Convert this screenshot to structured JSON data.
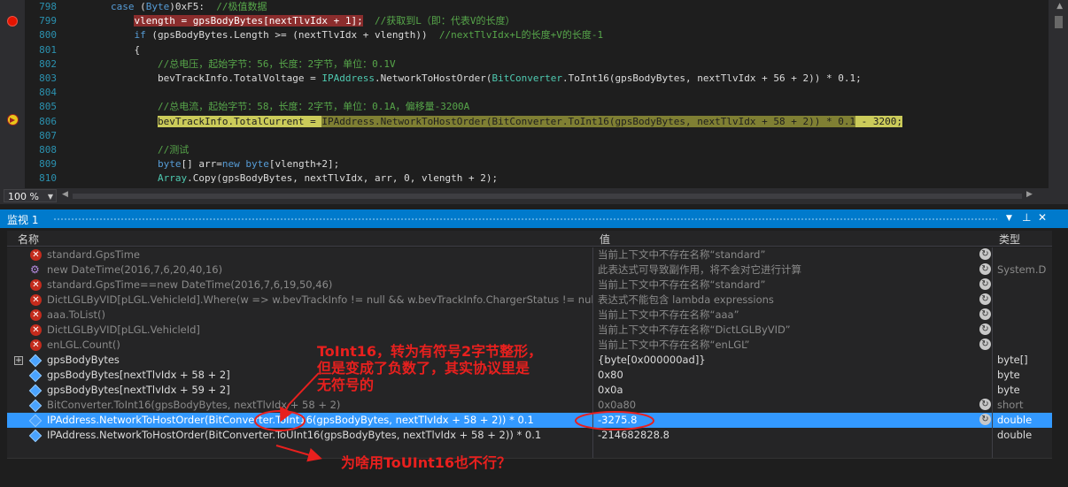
{
  "editor": {
    "lines": [
      {
        "num": "798",
        "segments": [
          {
            "t": "        ",
            "c": ""
          },
          {
            "t": "case",
            "c": "kw"
          },
          {
            "t": " (",
            "c": ""
          },
          {
            "t": "Byte",
            "c": "kw"
          },
          {
            "t": ")0xF5:  ",
            "c": ""
          },
          {
            "t": "//极值数据",
            "c": "cm"
          }
        ]
      },
      {
        "num": "799",
        "segments": [
          {
            "t": "            ",
            "c": ""
          },
          {
            "t": "vlength = gpsBodyBytes[nextTlvIdx + 1];",
            "c": "hl-red"
          },
          {
            "t": "  ",
            "c": ""
          },
          {
            "t": "//获取到L（即：代表V的长度）",
            "c": "cm"
          }
        ]
      },
      {
        "num": "800",
        "segments": [
          {
            "t": "            ",
            "c": ""
          },
          {
            "t": "if",
            "c": "kw"
          },
          {
            "t": " (gpsBodyBytes.Length >= (nextTlvIdx + vlength))  ",
            "c": ""
          },
          {
            "t": "//nextTlvIdx+L的长度+V的长度-1",
            "c": "cm"
          }
        ]
      },
      {
        "num": "801",
        "segments": [
          {
            "t": "            {",
            "c": ""
          }
        ]
      },
      {
        "num": "802",
        "segments": [
          {
            "t": "                ",
            "c": ""
          },
          {
            "t": "//总电压，起始字节：56，长度：2字节，单位：0.1V",
            "c": "cm"
          }
        ]
      },
      {
        "num": "803",
        "segments": [
          {
            "t": "                bevTrackInfo.TotalVoltage = ",
            "c": ""
          },
          {
            "t": "IPAddress",
            "c": "ty"
          },
          {
            "t": ".NetworkToHostOrder(",
            "c": ""
          },
          {
            "t": "BitConverter",
            "c": "ty"
          },
          {
            "t": ".ToInt16(gpsBodyBytes, nextTlvIdx + 56 + 2)) * 0.1;",
            "c": ""
          }
        ]
      },
      {
        "num": "804",
        "segments": [
          {
            "t": "",
            "c": ""
          }
        ]
      },
      {
        "num": "805",
        "segments": [
          {
            "t": "                ",
            "c": ""
          },
          {
            "t": "//总电流，起始字节：58，长度：2字节，单位：0.1A，偏移量-3200A",
            "c": "cm"
          }
        ]
      },
      {
        "num": "806",
        "segments": [
          {
            "t": "                ",
            "c": ""
          },
          {
            "t": "bevTrackInfo.TotalCurrent = ",
            "c": "hl-yel"
          },
          {
            "t": "IPAddress.NetworkToHostOrder(BitConverter.ToInt16(gpsBodyBytes, nextTlvIdx + 58 + 2)) * 0.1",
            "c": "hl-yel2"
          },
          {
            "t": " - 3200;",
            "c": "hl-yel"
          }
        ]
      },
      {
        "num": "807",
        "segments": [
          {
            "t": "",
            "c": ""
          }
        ]
      },
      {
        "num": "808",
        "segments": [
          {
            "t": "                ",
            "c": ""
          },
          {
            "t": "//测试",
            "c": "cm"
          }
        ]
      },
      {
        "num": "809",
        "segments": [
          {
            "t": "                ",
            "c": ""
          },
          {
            "t": "byte",
            "c": "kw"
          },
          {
            "t": "[] arr=",
            "c": ""
          },
          {
            "t": "new",
            "c": "kw"
          },
          {
            "t": " ",
            "c": ""
          },
          {
            "t": "byte",
            "c": "kw"
          },
          {
            "t": "[vlength+2];",
            "c": ""
          }
        ]
      },
      {
        "num": "810",
        "segments": [
          {
            "t": "                ",
            "c": ""
          },
          {
            "t": "Array",
            "c": "ty"
          },
          {
            "t": ".Copy(gpsBodyBytes, nextTlvIdx, arr, 0, vlength + 2);",
            "c": ""
          }
        ]
      }
    ],
    "zoom": "100 %"
  },
  "watch": {
    "title": "监视 1",
    "headers": {
      "name": "名称",
      "value": "值",
      "type": "类型"
    },
    "rows": [
      {
        "icon": "error",
        "name": "standard.GpsTime",
        "value": "当前上下文中不存在名称“standard”",
        "type": "",
        "dim": true,
        "refresh": true
      },
      {
        "icon": "gear",
        "name": "new DateTime(2016,7,6,20,40,16)",
        "value": "此表达式可导致副作用，将不会对它进行计算",
        "type": "System.D",
        "dim": true,
        "refresh": true
      },
      {
        "icon": "error",
        "name": "standard.GpsTime==new DateTime(2016,7,6,19,50,46)",
        "value": "当前上下文中不存在名称“standard”",
        "type": "",
        "dim": true,
        "refresh": true
      },
      {
        "icon": "error",
        "name": "DictLGLByVID[pLGL.VehicleId].Where(w => w.bevTrackInfo != null && w.bevTrackInfo.ChargerStatus != null)",
        "value": "表达式不能包含 lambda expressions",
        "type": "",
        "dim": true,
        "refresh": true
      },
      {
        "icon": "error",
        "name": "aaa.ToList()",
        "value": "当前上下文中不存在名称“aaa”",
        "type": "",
        "dim": true,
        "refresh": true
      },
      {
        "icon": "error",
        "name": "DictLGLByVID[pLGL.VehicleId]",
        "value": "当前上下文中不存在名称“DictLGLByVID”",
        "type": "",
        "dim": true,
        "refresh": true
      },
      {
        "icon": "error",
        "name": "enLGL.Count()",
        "value": "当前上下文中不存在名称“enLGL”",
        "type": "",
        "dim": true,
        "refresh": true
      },
      {
        "icon": "cube",
        "name": "gpsBodyBytes",
        "value": "{byte[0x000000ad]}",
        "type": "byte[]",
        "dim": false,
        "refresh": false,
        "expand": true
      },
      {
        "icon": "cube",
        "name": "gpsBodyBytes[nextTlvIdx + 58 + 2]",
        "value": "0x80",
        "type": "byte",
        "dim": false,
        "refresh": false
      },
      {
        "icon": "cube",
        "name": "gpsBodyBytes[nextTlvIdx + 59 + 2]",
        "value": "0x0a",
        "type": "byte",
        "dim": false,
        "refresh": false
      },
      {
        "icon": "cube",
        "name": "BitConverter.ToInt16(gpsBodyBytes, nextTlvIdx + 58 + 2)",
        "value": "0x0a80",
        "type": "short",
        "dim": true,
        "refresh": true
      },
      {
        "icon": "cube",
        "name": "IPAddress.NetworkToHostOrder(BitConverter.ToInt16(gpsBodyBytes, nextTlvIdx + 58 + 2)) * 0.1",
        "value": "-3275.8",
        "type": "double",
        "dim": false,
        "refresh": true,
        "selected": true
      },
      {
        "icon": "cube",
        "name": "IPAddress.NetworkToHostOrder(BitConverter.ToUInt16(gpsBodyBytes, nextTlvIdx + 58 + 2)) * 0.1",
        "value": "-214682828.8",
        "type": "double",
        "dim": false,
        "refresh": false
      }
    ]
  },
  "annotations": {
    "a1_line1": "ToInt16，转为有符号2字节整形，",
    "a1_line2": "但是变成了负数了，其实协议里是",
    "a1_line3": "无符号的",
    "a2": "为啥用ToUInt16也不行？"
  },
  "colors": {
    "accent": "#007acc",
    "annotation": "#e8201e",
    "selection": "#3399ff"
  }
}
